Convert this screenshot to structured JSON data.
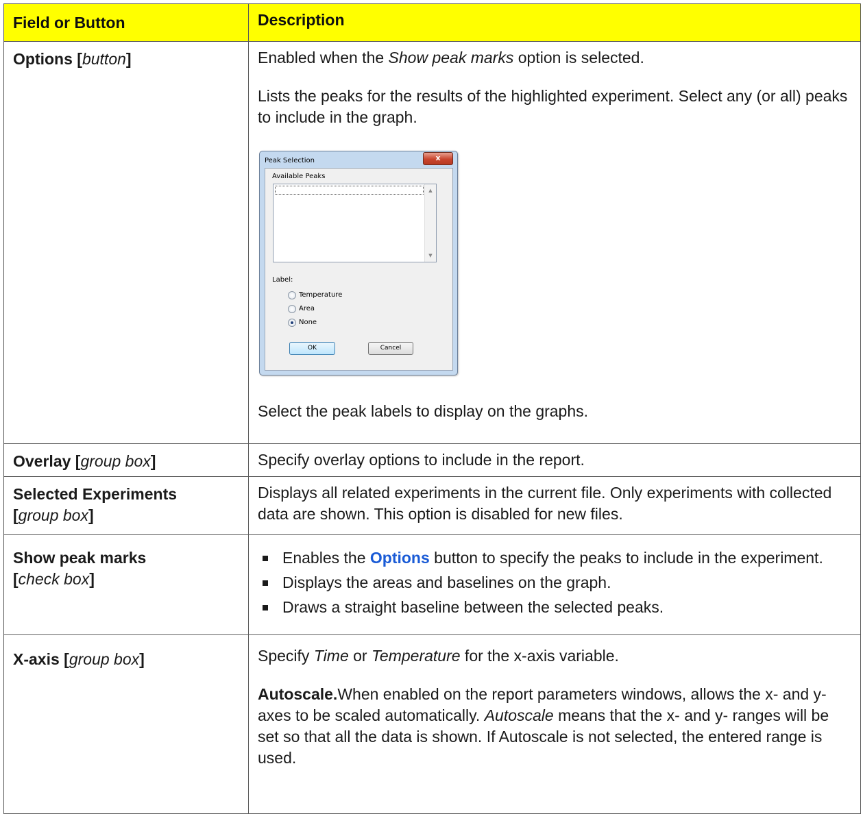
{
  "table": {
    "headers": {
      "field": "Field or Button",
      "description": "Description"
    },
    "options_row": {
      "field_name": "Options",
      "field_type": "button",
      "desc_line1_pre": "Enabled when the ",
      "desc_line1_em": "Show peak marks",
      "desc_line1_post": " option is selected.",
      "desc_line2": "Lists the peaks for the results of the highlighted experiment. Select any (or all) peaks to include in the graph.",
      "desc_line3": "Select the peak labels to display on the graphs."
    },
    "overlay_row": {
      "field_name": "Overlay",
      "field_type": "group box",
      "description": "Specify overlay options to include in the report."
    },
    "selected_row": {
      "field_name": "Selected Experiments",
      "field_type": "group box",
      "description": "Displays all related experiments in the current file. Only experiments with collected data are shown. This option is disabled for new files."
    },
    "peakmarks_row": {
      "field_name": "Show peak marks",
      "field_type": "check box",
      "bullet1_pre": "Enables the ",
      "bullet1_link": "Options",
      "bullet1_post": " button to specify the peaks to include in the experiment.",
      "bullet2": "Displays the areas and baselines on the graph.",
      "bullet3": "Draws a straight baseline between the selected peaks."
    },
    "xaxis_row": {
      "field_name": "X-axis",
      "field_type": "group box",
      "desc_line1_pre": "Specify ",
      "desc_line1_em1": "Time",
      "desc_line1_mid": " or ",
      "desc_line1_em2": "Temperature",
      "desc_line1_post": " for the x-axis variable.",
      "autoscale_label": "Autoscale.",
      "autoscale_text1": "When enabled on the report parameters windows, allows the x- and y- axes to be scaled automatically. ",
      "autoscale_em": "Autoscale",
      "autoscale_text2": " means that the x- and y- ranges will be set so that all the data is shown. If Autoscale is not selected, the entered range is used."
    }
  },
  "dialog": {
    "title": "Peak Selection",
    "close_glyph": "x",
    "available_peaks_label": "Available Peaks",
    "label_caption": "Label:",
    "radio_options": [
      "Temperature",
      "Area",
      "None"
    ],
    "selected_option": "None",
    "ok_label": "OK",
    "cancel_label": "Cancel"
  },
  "colors": {
    "header_bg": "#ffff00",
    "link": "#1a5bd6",
    "dialog_frame": "#c4d9ef"
  }
}
